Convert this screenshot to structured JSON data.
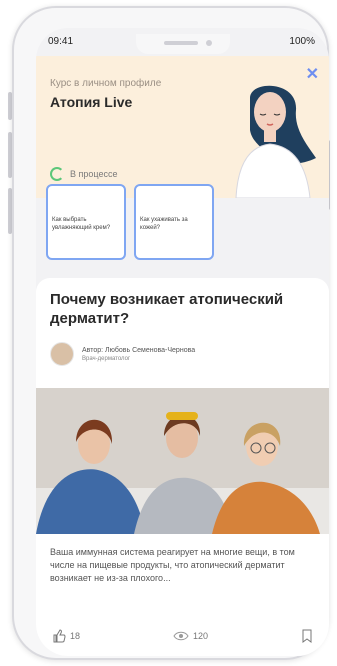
{
  "status": {
    "time": "09:41",
    "battery": "100%"
  },
  "hero": {
    "kicker": "Курс в личном профиле",
    "title": "Атопия Live",
    "progress_label": "В процессе",
    "close_icon": "close-icon",
    "bg_color": "#fcefdc"
  },
  "stories": [
    {
      "text": "Как выбрать увлажняющий крем?"
    },
    {
      "text": "Как ухаживать за кожей?"
    }
  ],
  "article": {
    "title": "Почему возникает атопический дерматит?",
    "author_label": "Автор: Любовь Семенова-Чернова",
    "author_role": "Врач-дерматолог",
    "excerpt": "Ваша иммунная система реагирует на многие вещи, в том числе на пищевые продукты, что атопический дерматит возникает не из-за плохого...",
    "likes": "18",
    "views": "120"
  },
  "colors": {
    "accent": "#7fa6f2",
    "progress": "#5cc77a"
  }
}
